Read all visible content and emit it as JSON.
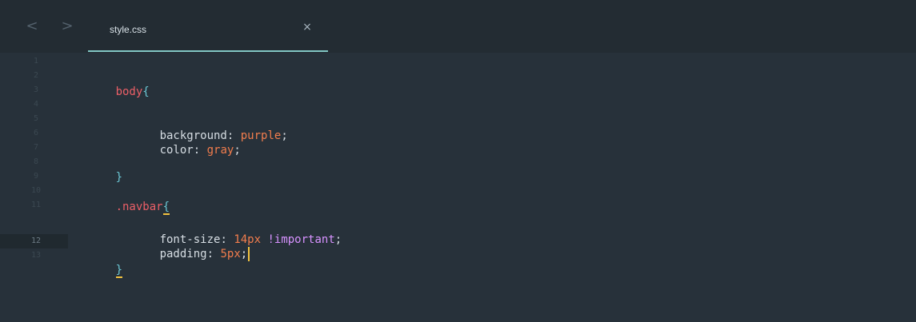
{
  "window": {
    "title": "style.css"
  },
  "navigation": {
    "back_icon": "chevron-left-icon",
    "forward_icon": "chevron-right-icon",
    "back_glyph": "<",
    "forward_glyph": ">"
  },
  "tab": {
    "label": "style.css",
    "close_glyph": "×",
    "close_icon": "close-icon"
  },
  "editor": {
    "line_numbers": [
      "1",
      "2",
      "3",
      "4",
      "5",
      "6",
      "7",
      "8",
      "9",
      "10",
      "11",
      "12",
      "13"
    ],
    "current_line": "12",
    "code": {
      "line2": {
        "selector": "body",
        "brace": "{"
      },
      "line4": {
        "property": "background",
        "colon": ":",
        "value": "purple",
        "semicolon": ";"
      },
      "line5": {
        "property": "color",
        "colon": ":",
        "value": "gray",
        "semicolon": ";"
      },
      "line7": {
        "brace": "}"
      },
      "line9": {
        "selector": ".navbar",
        "brace": "{"
      },
      "line11": {
        "property": "font-size",
        "colon": ":",
        "number": "14",
        "unit": "px",
        "important": "!important",
        "semicolon": ";"
      },
      "line12": {
        "property": "padding",
        "colon": ":",
        "number": "5",
        "unit": "px",
        "semicolon": ";"
      },
      "line13": {
        "brace": "}"
      }
    }
  },
  "colors": {
    "background": "#27313a",
    "selector": "#ec5f67",
    "brace": "#6bc6d3",
    "property": "#d7dee4",
    "value": "#f27d4d",
    "important": "#d792ff",
    "tab_underline": "#81c6c4",
    "cursor": "#f2c23f"
  }
}
